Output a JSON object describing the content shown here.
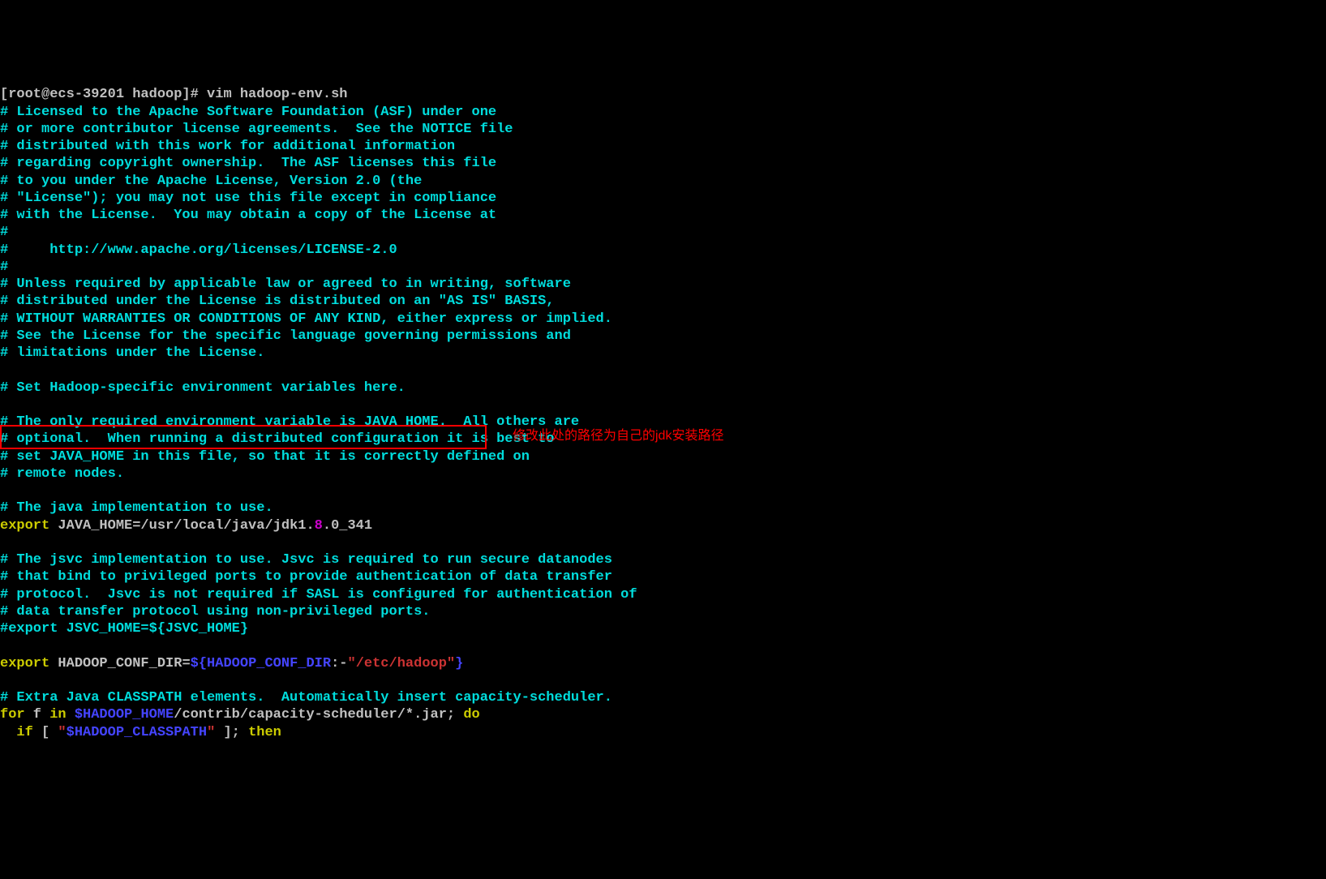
{
  "prompt": "[root@ecs-39201 hadoop]# vim hadoop-env.sh",
  "lines": {
    "l1": "# Licensed to the Apache Software Foundation (ASF) under one",
    "l2": "# or more contributor license agreements.  See the NOTICE file",
    "l3": "# distributed with this work for additional information",
    "l4": "# regarding copyright ownership.  The ASF licenses this file",
    "l5": "# to you under the Apache License, Version 2.0 (the",
    "l6": "# \"License\"); you may not use this file except in compliance",
    "l7": "# with the License.  You may obtain a copy of the License at",
    "l8": "#",
    "l9": "#     http://www.apache.org/licenses/LICENSE-2.0",
    "l10": "#",
    "l11": "# Unless required by applicable law or agreed to in writing, software",
    "l12": "# distributed under the License is distributed on an \"AS IS\" BASIS,",
    "l13": "# WITHOUT WARRANTIES OR CONDITIONS OF ANY KIND, either express or implied.",
    "l14": "# See the License for the specific language governing permissions and",
    "l15": "# limitations under the License.",
    "l16": "",
    "l17": "# Set Hadoop-specific environment variables here.",
    "l18": "",
    "l19": "# The only required environment variable is JAVA_HOME.  All others are",
    "l20": "# optional.  When running a distributed configuration it is best to",
    "l21": "# set JAVA_HOME in this file, so that it is correctly defined on",
    "l22": "# remote nodes.",
    "l23": "",
    "l24": "# The java implementation to use.",
    "export_kw": "export",
    "java_home_pre": " JAVA_HOME=/usr/local/java/jdk1.",
    "java_home_num": "8",
    "java_home_post": ".0_341",
    "l26": "",
    "l27": "# The jsvc implementation to use. Jsvc is required to run secure datanodes",
    "l28": "# that bind to privileged ports to provide authentication of data transfer",
    "l29": "# protocol.  Jsvc is not required if SASL is configured for authentication of",
    "l30": "# data transfer protocol using non-privileged ports.",
    "l31": "#export JSVC_HOME=${JSVC_HOME}",
    "l32": "",
    "hadoop_conf_pre": " HADOOP_CONF_DIR=",
    "hadoop_conf_dollar": "${HADOOP_CONF_DIR",
    "hadoop_conf_colon": ":-",
    "hadoop_conf_str": "\"/etc/hadoop\"",
    "hadoop_conf_close": "}",
    "l34": "",
    "l35": "# Extra Java CLASSPATH elements.  Automatically insert capacity-scheduler.",
    "for_kw": "for",
    "for_f": " f ",
    "in_kw": "in ",
    "hadoop_home_var": "$HADOOP_HOME",
    "for_path": "/contrib/capacity-scheduler/*.jar; ",
    "do_kw": "do",
    "if_indent": "  ",
    "if_kw": "if",
    "if_bracket": " [ ",
    "hadoop_cp_q1": "\"",
    "hadoop_cp_var": "$HADOOP_CLASSPATH",
    "hadoop_cp_q2": "\"",
    "if_close": " ]; ",
    "then_kw": "then"
  },
  "annotation": "修改此处的路径为自己的jdk安装路径"
}
